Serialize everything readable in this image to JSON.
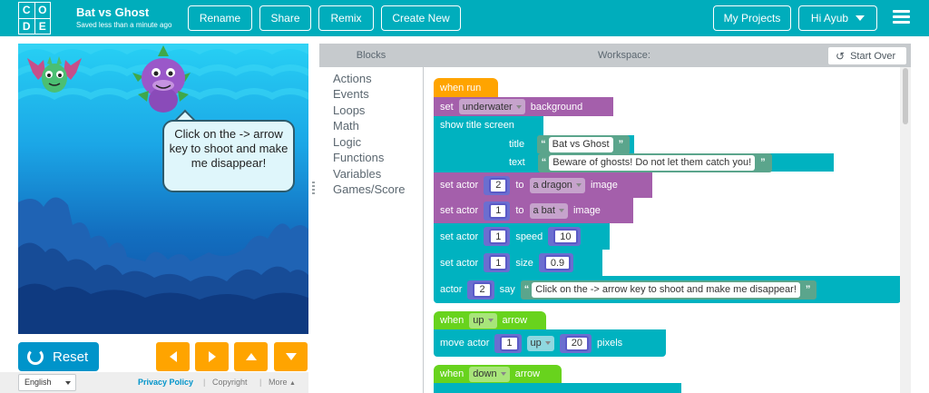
{
  "header": {
    "logo_letters": [
      "C",
      "O",
      "D",
      "E"
    ],
    "project_title": "Bat vs Ghost",
    "saved_text": "Saved less than a minute ago",
    "buttons": {
      "rename": "Rename",
      "share": "Share",
      "remix": "Remix",
      "create_new": "Create New",
      "my_projects": "My Projects",
      "user": "Hi Ayub"
    }
  },
  "game": {
    "speech_bubble": "Click on the -> arrow key to shoot and make me disappear!"
  },
  "controls": {
    "reset": "Reset"
  },
  "footer": {
    "language": "English",
    "privacy": "Privacy Policy",
    "sep": "|",
    "copyright": "Copyright",
    "more": "More"
  },
  "toolbox": {
    "title": "Blocks",
    "categories": [
      "Actions",
      "Events",
      "Loops",
      "Math",
      "Logic",
      "Functions",
      "Variables",
      "Games/Score"
    ]
  },
  "workspace": {
    "title": "Workspace:",
    "start_over": "Start Over",
    "blocks": {
      "when_run": "when run",
      "set": "set",
      "background_value": "underwater",
      "background": "background",
      "show_title": "show title screen",
      "title_label": "title",
      "title_value": "Bat vs Ghost",
      "text_label": "text",
      "text_value": "Beware of ghosts! Do not let them catch you!",
      "set_actor": "set actor",
      "actor_2": "2",
      "to": "to",
      "dragon": "a dragon",
      "image": "image",
      "actor_1": "1",
      "bat": "a bat",
      "speed": "speed",
      "speed_value": "10",
      "size": "size",
      "size_value": "0.9",
      "actor": "actor",
      "say": "say",
      "say_value": "Click on the -> arrow key to shoot and make me disappear!",
      "when": "when",
      "up": "up",
      "arrow": "arrow",
      "move_actor": "move actor",
      "move_value": "20",
      "pixels": "pixels",
      "down": "down"
    }
  },
  "colors": {
    "header": "#00adbc",
    "events": "#ffa400",
    "events_green": "#68d31d",
    "actions": "#00b2c0",
    "looks": "#a45fab",
    "text": "#5ba58c",
    "reset": "#0094ca"
  }
}
